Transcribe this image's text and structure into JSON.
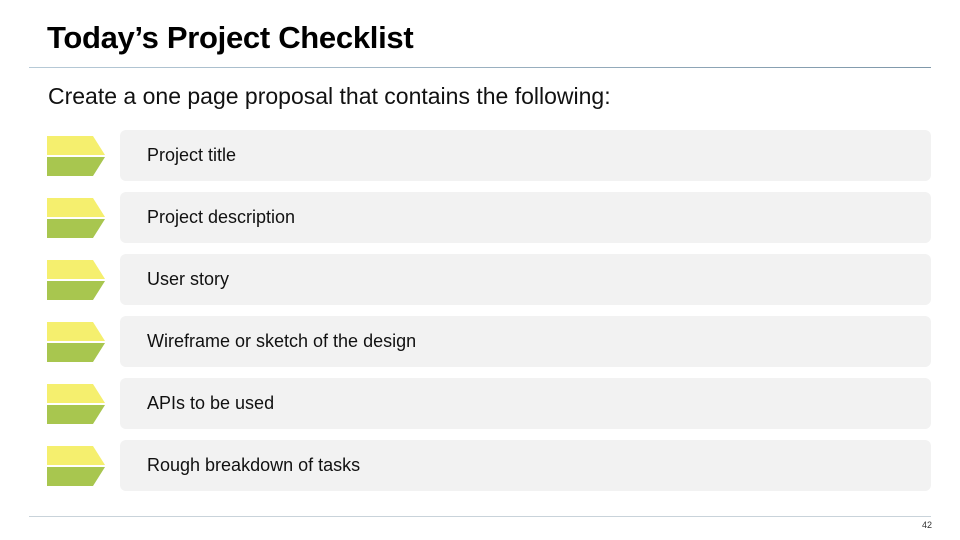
{
  "slide": {
    "title": "Today’s Project Checklist",
    "subtitle": "Create a one page proposal that contains the following:",
    "page_number": "42"
  },
  "colors": {
    "marker_top": "#f5ef6e",
    "marker_bottom": "#a8c64f",
    "card_background": "#f2f2f2"
  },
  "checklist": [
    {
      "label": "Project title",
      "icon": "arrow-marker-icon"
    },
    {
      "label": "Project description",
      "icon": "arrow-marker-icon"
    },
    {
      "label": "User story",
      "icon": "arrow-marker-icon"
    },
    {
      "label": "Wireframe or sketch of the design",
      "icon": "arrow-marker-icon"
    },
    {
      "label": "APIs to be used",
      "icon": "arrow-marker-icon"
    },
    {
      "label": "Rough breakdown of tasks",
      "icon": "arrow-marker-icon"
    }
  ]
}
